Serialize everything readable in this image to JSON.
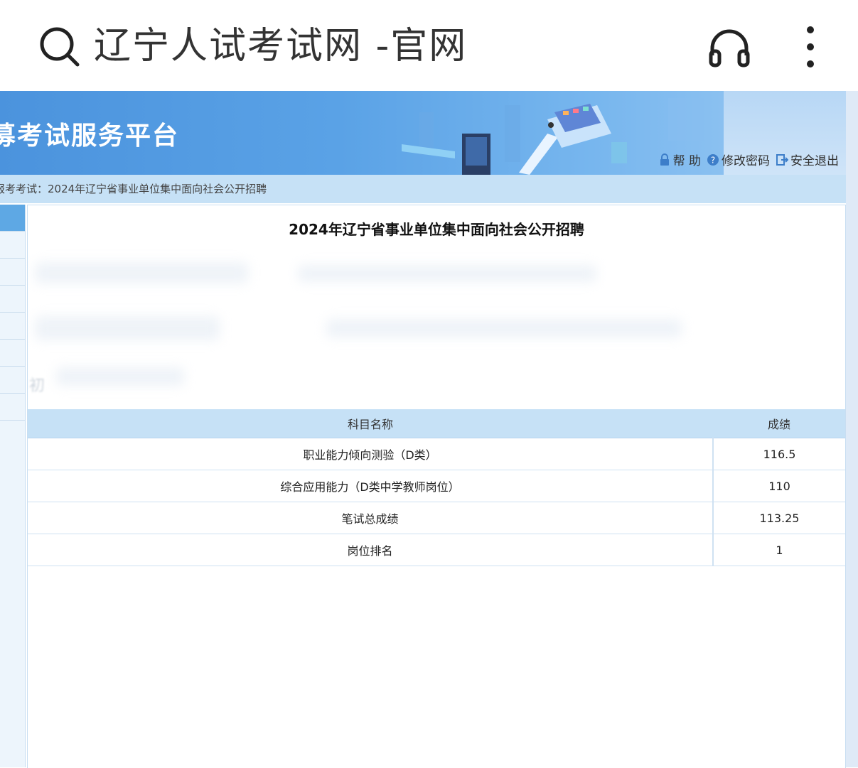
{
  "browser": {
    "search_title": "辽宁人试考试网 -官网",
    "icons": [
      "search-icon",
      "headphones-icon",
      "more-vertical-icon"
    ]
  },
  "banner": {
    "title": "募考试服务平台",
    "links": {
      "help": "帮 助",
      "change_password": "修改密码",
      "logout": "安全退出"
    }
  },
  "breadcrumb": "报考考试：2024年辽宁省事业单位集中面向社会公开招聘",
  "content": {
    "title": "2024年辽宁省事业单位集中面向社会公开招聘",
    "blurred_fragment": "初"
  },
  "score_table": {
    "headers": [
      "科目名称",
      "成绩"
    ],
    "rows": [
      {
        "subject": "职业能力倾向测验（D类）",
        "score": "116.5"
      },
      {
        "subject": "综合应用能力（D类中学教师岗位）",
        "score": "110"
      },
      {
        "subject": "笔试总成绩",
        "score": "113.25"
      },
      {
        "subject": "岗位排名",
        "score": "1"
      }
    ]
  },
  "colors": {
    "banner_blue": "#4b93dd",
    "header_light_blue": "#c6e1f6",
    "sidebar_active": "#5ea8e4"
  }
}
